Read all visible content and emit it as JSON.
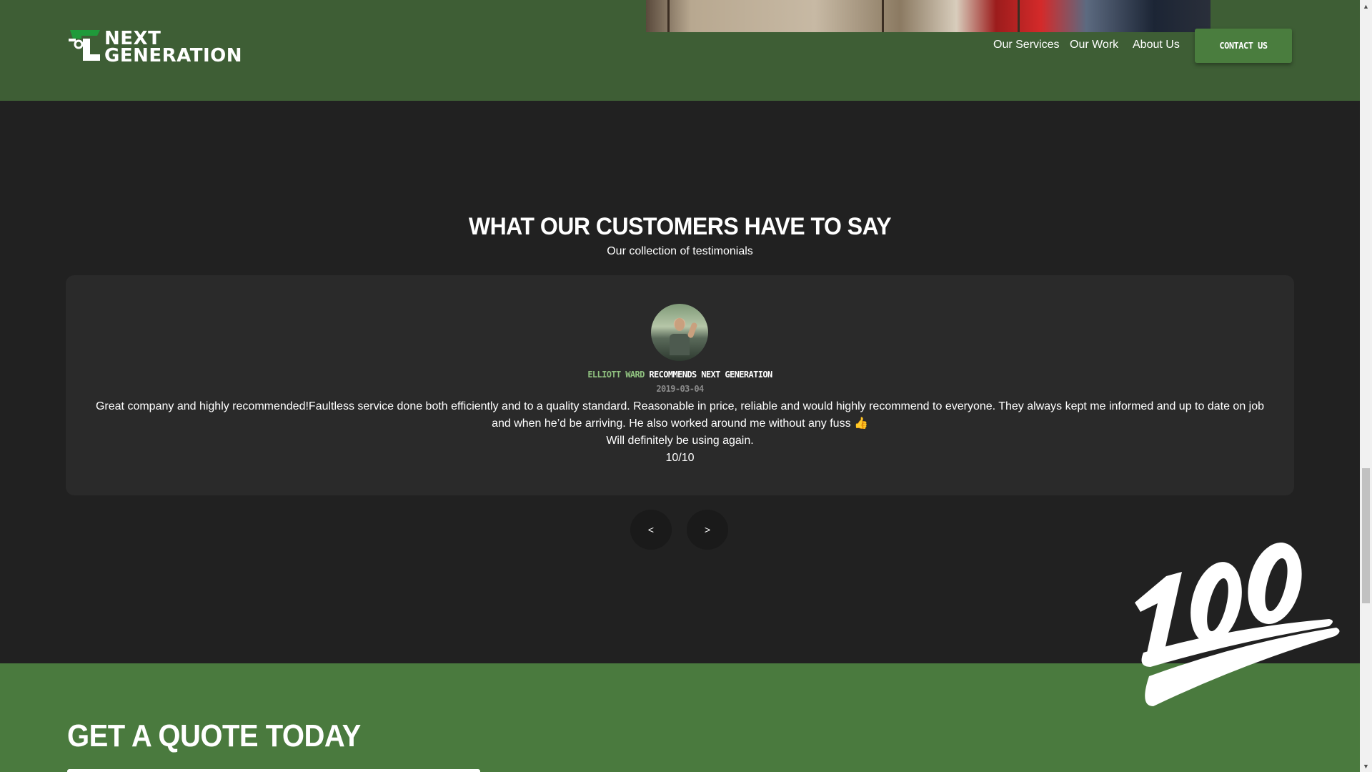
{
  "header": {
    "brand_line1": "NEXT",
    "brand_line2": "GENERATION",
    "nav": [
      {
        "label": "Our Services"
      },
      {
        "label": "Our Work"
      },
      {
        "label": "About Us"
      }
    ],
    "contact_label": "Contact Us",
    "colors": {
      "header_bg": "#3e5e35",
      "button_bg": "#4a7d3e",
      "logo_accent": "#1f9a3a"
    }
  },
  "testimonials": {
    "title": "What our customers have to say",
    "subtitle": "Our collection of testimonials",
    "review": {
      "reviewer_name": "Elliott Ward",
      "recommends_text": " recommends Next Generation",
      "date": "2019-03-04",
      "body_line1": "Great company and highly recommended!Faultless service done both efficiently and to a quality standard. Reasonable in price, reliable and would highly recommend to everyone. They always kept me informed and up to date on job and when he’d be arriving. He also worked around me without any fuss 👍",
      "body_line2": "Will definitely be using again.",
      "body_line3": "10/10"
    },
    "prev_label": "<",
    "next_label": ">",
    "colors": {
      "section_bg": "#212121",
      "card_bg": "#2a2a2a",
      "name_color": "#8fc07f",
      "date_color": "#8a8a8a"
    }
  },
  "quote": {
    "title": "Get a quote today",
    "colors": {
      "bg": "#4a7a3e"
    }
  },
  "scrollbar": {
    "up_icon": "▲",
    "down_icon": "▼"
  }
}
